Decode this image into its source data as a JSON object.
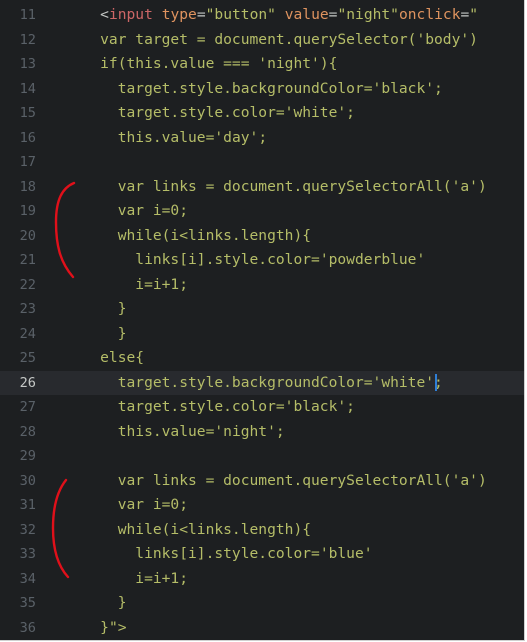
{
  "editor": {
    "active_line": 26,
    "lines": [
      {
        "num": "11",
        "tokens": [
          {
            "t": "    ",
            "c": "plain"
          },
          {
            "t": "<",
            "c": "punct"
          },
          {
            "t": "input",
            "c": "tag"
          },
          {
            "t": " ",
            "c": "plain"
          },
          {
            "t": "type",
            "c": "attr"
          },
          {
            "t": "=",
            "c": "punct"
          },
          {
            "t": "\"button\"",
            "c": "str"
          },
          {
            "t": " ",
            "c": "plain"
          },
          {
            "t": "value",
            "c": "attr"
          },
          {
            "t": "=",
            "c": "punct"
          },
          {
            "t": "\"night\"",
            "c": "str"
          },
          {
            "t": "onclick",
            "c": "attr"
          },
          {
            "t": "=",
            "c": "punct"
          },
          {
            "t": "\"",
            "c": "str"
          }
        ]
      },
      {
        "num": "12",
        "tokens": [
          {
            "t": "    var target = document.querySelector(",
            "c": "green"
          },
          {
            "t": "'body'",
            "c": "green"
          },
          {
            "t": ")",
            "c": "green"
          }
        ]
      },
      {
        "num": "13",
        "tokens": [
          {
            "t": "    if(this.value === ",
            "c": "green"
          },
          {
            "t": "'night'",
            "c": "green"
          },
          {
            "t": "){",
            "c": "green"
          }
        ]
      },
      {
        "num": "14",
        "tokens": [
          {
            "t": "      target.style.backgroundColor=",
            "c": "green"
          },
          {
            "t": "'black'",
            "c": "green"
          },
          {
            "t": ";",
            "c": "green"
          }
        ]
      },
      {
        "num": "15",
        "tokens": [
          {
            "t": "      target.style.color=",
            "c": "green"
          },
          {
            "t": "'white'",
            "c": "green"
          },
          {
            "t": ";",
            "c": "green"
          }
        ]
      },
      {
        "num": "16",
        "tokens": [
          {
            "t": "      this.value=",
            "c": "green"
          },
          {
            "t": "'day'",
            "c": "green"
          },
          {
            "t": ";",
            "c": "green"
          }
        ]
      },
      {
        "num": "17",
        "tokens": []
      },
      {
        "num": "18",
        "tokens": [
          {
            "t": "      var links = document.querySelectorAll(",
            "c": "green"
          },
          {
            "t": "'a'",
            "c": "green"
          },
          {
            "t": ")",
            "c": "green"
          }
        ]
      },
      {
        "num": "19",
        "tokens": [
          {
            "t": "      var i=0;",
            "c": "green"
          }
        ]
      },
      {
        "num": "20",
        "tokens": [
          {
            "t": "      while(i<links.length){",
            "c": "green"
          }
        ]
      },
      {
        "num": "21",
        "tokens": [
          {
            "t": "        links[i].style.color=",
            "c": "green"
          },
          {
            "t": "'powderblue'",
            "c": "green"
          }
        ]
      },
      {
        "num": "22",
        "tokens": [
          {
            "t": "        i=i+1;",
            "c": "green"
          }
        ]
      },
      {
        "num": "23",
        "tokens": [
          {
            "t": "      }",
            "c": "green"
          }
        ]
      },
      {
        "num": "24",
        "tokens": [
          {
            "t": "      }",
            "c": "green"
          }
        ]
      },
      {
        "num": "25",
        "tokens": [
          {
            "t": "    else{",
            "c": "green"
          }
        ]
      },
      {
        "num": "26",
        "tokens": [
          {
            "t": "      target.style.backgroundColor=",
            "c": "green"
          },
          {
            "t": "'white'",
            "c": "green"
          },
          {
            "t": "CURSOR",
            "c": "cursor"
          },
          {
            "t": ";",
            "c": "green"
          }
        ]
      },
      {
        "num": "27",
        "tokens": [
          {
            "t": "      target.style.color=",
            "c": "green"
          },
          {
            "t": "'black'",
            "c": "green"
          },
          {
            "t": ";",
            "c": "green"
          }
        ]
      },
      {
        "num": "28",
        "tokens": [
          {
            "t": "      this.value=",
            "c": "green"
          },
          {
            "t": "'night'",
            "c": "green"
          },
          {
            "t": ";",
            "c": "green"
          }
        ]
      },
      {
        "num": "29",
        "tokens": []
      },
      {
        "num": "30",
        "tokens": [
          {
            "t": "      var links = document.querySelectorAll(",
            "c": "green"
          },
          {
            "t": "'a'",
            "c": "green"
          },
          {
            "t": ")",
            "c": "green"
          }
        ]
      },
      {
        "num": "31",
        "tokens": [
          {
            "t": "      var i=0;",
            "c": "green"
          }
        ]
      },
      {
        "num": "32",
        "tokens": [
          {
            "t": "      while(i<links.length){",
            "c": "green"
          }
        ]
      },
      {
        "num": "33",
        "tokens": [
          {
            "t": "        links[i].style.color=",
            "c": "green"
          },
          {
            "t": "'blue'",
            "c": "green"
          }
        ]
      },
      {
        "num": "34",
        "tokens": [
          {
            "t": "        i=i+1;",
            "c": "green"
          }
        ]
      },
      {
        "num": "35",
        "tokens": [
          {
            "t": "      }",
            "c": "green"
          }
        ]
      },
      {
        "num": "36",
        "tokens": [
          {
            "t": "    }",
            "c": "green"
          },
          {
            "t": "\">",
            "c": "str"
          }
        ]
      }
    ]
  },
  "annotations": {
    "color": "#e0101a",
    "brackets": [
      "red-bracket-upper",
      "red-bracket-lower"
    ]
  },
  "colors": {
    "background": "#1d1f21",
    "active_line": "#282a2e",
    "gutter": "#5a6168",
    "code": "#b5bd68",
    "tag": "#cc6666",
    "attribute": "#de935f",
    "cursor": "#2f7fd6"
  }
}
